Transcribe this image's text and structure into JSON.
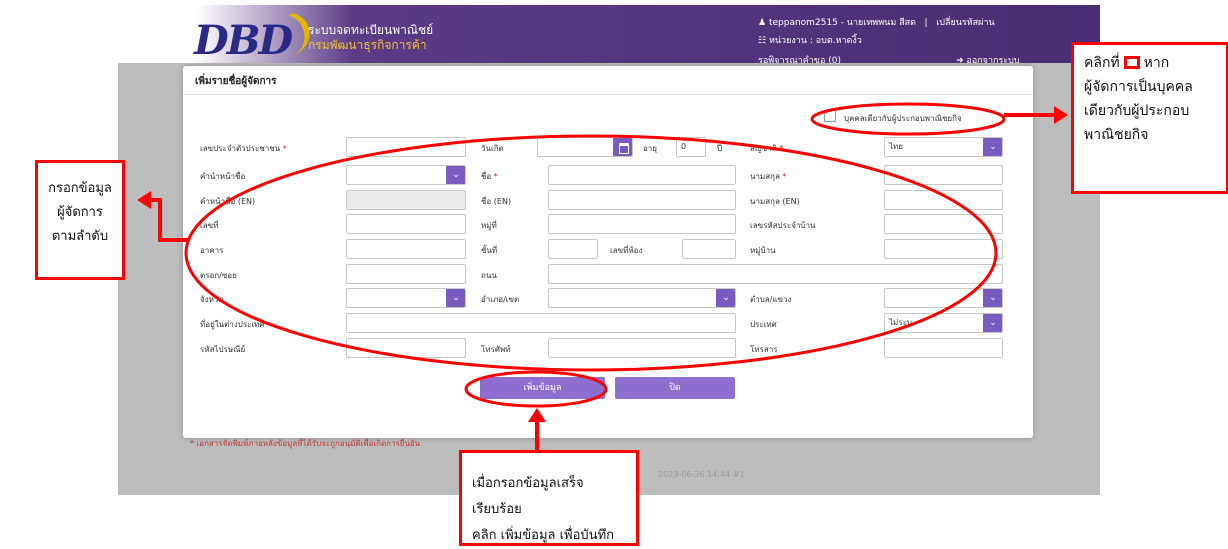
{
  "app": {
    "logo": "DBD",
    "system_name": "ระบบจดทะเบียนพาณิชย์",
    "department": "กรมพัฒนาธุรกิจการค้า",
    "user_info": "teppanom2515 - นายเทพพนม สีสด",
    "separator": "|",
    "change_password": "เปลี่ยนรหัสผ่าน",
    "unit": "หน่วยงาน : อบต.หาดงิ้ว",
    "pending": "รอพิจารณาคำขอ (0)",
    "logout": "ออกจากระบบ",
    "bg_note": "* เอกสารจัดพิมพ์ภายหลังข้อมูลที่ได้รับจะถูกอนุมัติเพื่อเกิดการยืนยัน",
    "bg_stamp": "2023-06-26 14:44 #1"
  },
  "modal": {
    "title": "เพิ่มรายชื่อผู้จัดการ",
    "same_person_label": "บุคคลเดียวกับผู้ประกอบพาณิชยกิจ",
    "labels": {
      "id_card": "เลขประจำตัวประชาชน",
      "birth_date": "วันเกิด",
      "age": "อายุ",
      "age_unit": "ปี",
      "nationality": "สัญชาติ",
      "prefix": "คำนำหน้าชื่อ",
      "first_name": "ชื่อ",
      "last_name": "นามสกุล",
      "prefix_en": "คำหน้าชื่อ (EN)",
      "first_name_en": "ชื่อ (EN)",
      "last_name_en": "นามสกุล (EN)",
      "house_no": "เลขที่",
      "moo": "หมู่ที่",
      "house_code": "เลขรหัสประจำบ้าน",
      "building": "อาคาร",
      "floor": "ชั้นที่",
      "room": "เลขที่ห้อง",
      "village": "หมู่บ้าน",
      "soi": "ตรอก/ซอย",
      "road": "ถนน",
      "province": "จังหวัด",
      "district": "อำเภอ/เขต",
      "subdistrict": "ตำบล/แขวง",
      "foreign_address": "ที่อยู่ในต่างประเทศ",
      "country": "ประเทศ",
      "postcode": "รหัสไปรษณีย์",
      "phone": "โทรศัพท์",
      "fax": "โทรสาร"
    },
    "required_mark": "*",
    "values": {
      "age": "0",
      "nationality": "ไทย",
      "country": "ไม่ระบุ"
    },
    "add_button": "เพิ่มข้อมูล",
    "close_button": "ปิด"
  },
  "annotations": {
    "right_prefix": "คลิกที่",
    "right_suffix": "หาก",
    "right_line2": "ผู้จัดการเป็นบุคคล",
    "right_line3": "เดียวกับผู้ประกอบ",
    "right_line4": "พาณิชยกิจ",
    "left_line1": "กรอกข้อมูล",
    "left_line2": "ผู้จัดการ",
    "left_line3": "ตามลำดับ",
    "bottom_line1": "เมื่อกรอกข้อมูลเสร็จเรียบร้อย",
    "bottom_line2": "คลิก เพิ่มข้อมูล เพื่อบันทึก",
    "annotation_color": "#ff0000",
    "accent_color": "#7a5cc0"
  }
}
